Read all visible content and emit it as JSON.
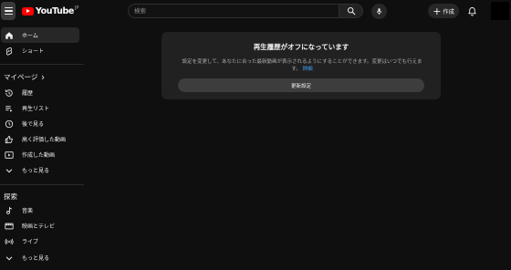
{
  "header": {
    "logo_text": "YouTube",
    "region": "JP",
    "search_placeholder": "検索",
    "create_label": "作成"
  },
  "sidebar": {
    "primary": [
      {
        "label": "ホーム",
        "icon": "home-icon",
        "active": true
      },
      {
        "label": "ショート",
        "icon": "shorts-icon"
      }
    ],
    "my_page": {
      "title": "マイページ",
      "items": [
        {
          "label": "履歴",
          "icon": "history-icon"
        },
        {
          "label": "再生リスト",
          "icon": "playlist-icon"
        },
        {
          "label": "後で見る",
          "icon": "clock-icon"
        },
        {
          "label": "高く評価した動画",
          "icon": "thumbs-up-icon"
        },
        {
          "label": "作成した動画",
          "icon": "video-icon"
        },
        {
          "label": "もっと見る",
          "icon": "chevron-down-icon"
        }
      ]
    },
    "explore": {
      "title": "探索",
      "items": [
        {
          "label": "音楽",
          "icon": "music-icon"
        },
        {
          "label": "映画とテレビ",
          "icon": "film-icon"
        },
        {
          "label": "ライブ",
          "icon": "live-icon"
        },
        {
          "label": "もっと見る",
          "icon": "chevron-down-icon"
        }
      ]
    }
  },
  "notice": {
    "title": "再生履歴がオフになっています",
    "body": "設定を変更して、あなたに合った最新動画が表示されるようにすることができます。変更はいつでも行えます。",
    "link": "詳細",
    "button": "更新設定"
  },
  "colors": {
    "background": "#0f0f0f",
    "card": "#212121",
    "active_item": "#272727",
    "brand_red": "#ff0000",
    "link_blue": "#3ea6ff"
  }
}
